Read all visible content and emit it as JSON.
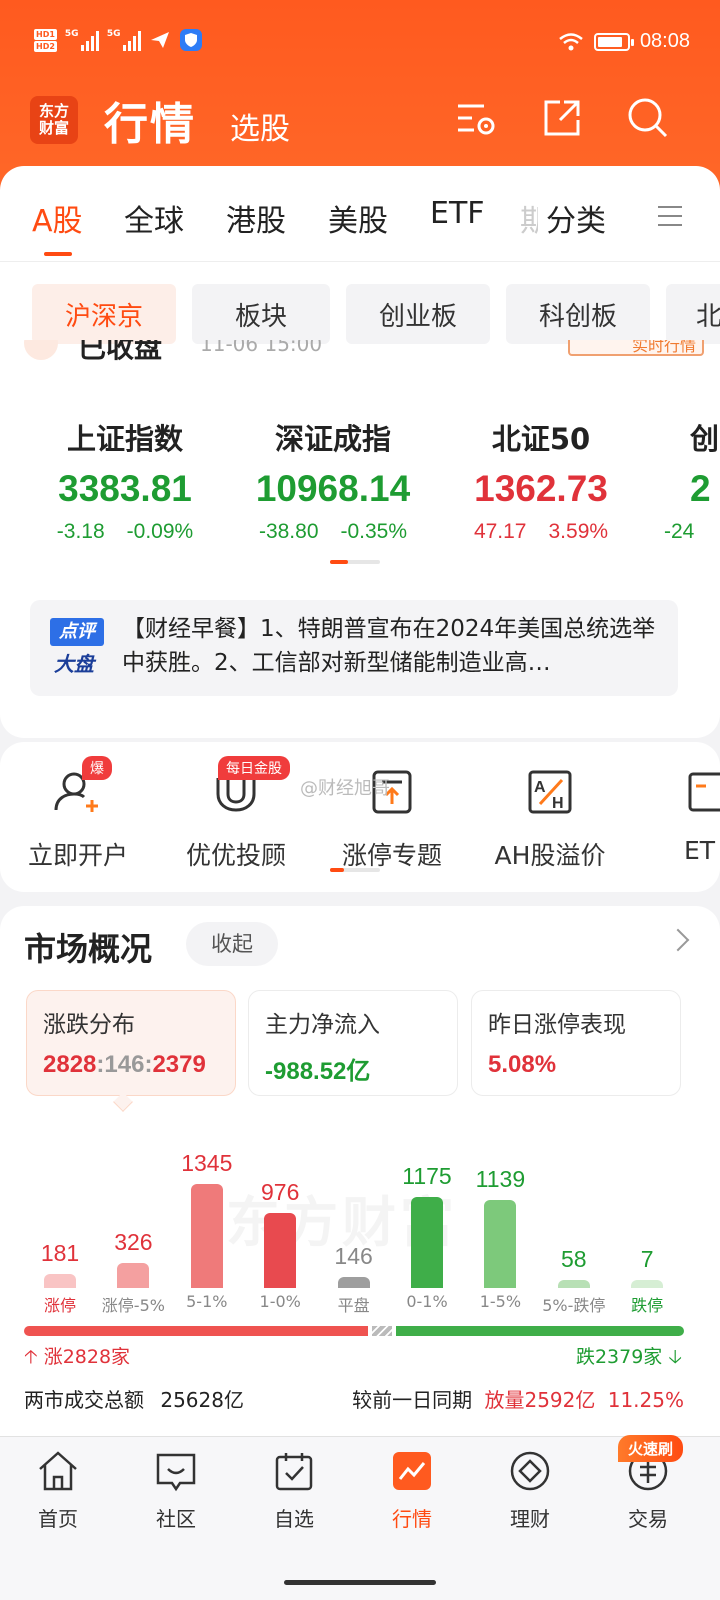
{
  "status_bar": {
    "hd1": "HD1",
    "hd2": "HD2",
    "net1": "5G",
    "net2": "5G",
    "time": "08:08"
  },
  "header": {
    "logo_line1": "东方",
    "logo_line2": "财富",
    "title": "行情",
    "subtitle": "选股"
  },
  "tabs": [
    {
      "label": "A股",
      "active": true
    },
    {
      "label": "全球"
    },
    {
      "label": "港股"
    },
    {
      "label": "美股"
    },
    {
      "label": "ETF"
    },
    {
      "label": "期"
    },
    {
      "label": "分类"
    }
  ],
  "chips": [
    {
      "label": "沪深京",
      "active": true
    },
    {
      "label": "板块"
    },
    {
      "label": "创业板"
    },
    {
      "label": "科创板"
    },
    {
      "label": "北"
    }
  ],
  "market_closed": {
    "label": "已收盘",
    "datetime": "11-06 15:00",
    "badge": "实时行情"
  },
  "indices": [
    {
      "name": "上证指数",
      "value": "3383.81",
      "change": "-3.18",
      "pct": "-0.09%",
      "dir": "down"
    },
    {
      "name": "深证成指",
      "value": "10968.14",
      "change": "-38.80",
      "pct": "-0.35%",
      "dir": "down"
    },
    {
      "name": "北证50",
      "value": "1362.73",
      "change": "47.17",
      "pct": "3.59%",
      "dir": "up"
    },
    {
      "name": "创",
      "value": "2",
      "change": "-24",
      "pct": "",
      "dir": "down"
    }
  ],
  "news": {
    "badge_line1": "点评",
    "badge_line2": "大盘",
    "text": "【财经早餐】1、特朗普宣布在2024年美国总统选举中获胜。2、工信部对新型储能制造业高…"
  },
  "quick": {
    "watermark": "@财经旭哥",
    "items": [
      {
        "label": "立即开户",
        "tag": "爆",
        "icon": "add-user-icon"
      },
      {
        "label": "优优投顾",
        "tag": "每日金股",
        "icon": "magnet-icon"
      },
      {
        "label": "涨停专题",
        "icon": "limit-up-icon"
      },
      {
        "label": "AH股溢价",
        "icon": "ah-premium-icon"
      },
      {
        "label": "ET",
        "icon": "etf-icon"
      }
    ]
  },
  "market": {
    "title": "市场概况",
    "collapse": "收起",
    "stats": [
      {
        "label": "涨跌分布",
        "value_up": "2828",
        "value_flat": "146",
        "value_down": "2379",
        "sep": ":"
      },
      {
        "label": "主力净流入",
        "value": "-988.52亿"
      },
      {
        "label": "昨日涨停表现",
        "value": "5.08%"
      }
    ],
    "watermark": "东方财富",
    "up_label": "涨2828家",
    "down_label": "跌2379家",
    "volume_label": "两市成交总额",
    "volume_value": "25628亿",
    "compare_label": "较前一日同期",
    "compare_value": "放量2592亿",
    "compare_pct": "11.25%"
  },
  "chart_data": {
    "type": "bar",
    "categories": [
      "涨停",
      "涨停-5%",
      "5-1%",
      "1-0%",
      "平盘",
      "0-1%",
      "1-5%",
      "5%-跌停",
      "跌停"
    ],
    "values": [
      181,
      326,
      1345,
      976,
      146,
      1175,
      1139,
      58,
      7
    ],
    "colors": [
      "#f9c4c4",
      "#f4a0a0",
      "#ef7a7a",
      "#e84a4f",
      "#9e9e9e",
      "#3fae49",
      "#7dc97b",
      "#b8e0b5",
      "#d6eed4"
    ],
    "label_colors": [
      "#e0323a",
      "#e0323a",
      "#e0323a",
      "#e0323a",
      "#888888",
      "#1e9c32",
      "#1e9c32",
      "#1e9c32",
      "#1e9c32"
    ],
    "tick_colors": [
      "#e0323a",
      "#888888",
      "#888888",
      "#888888",
      "#888888",
      "#888888",
      "#888888",
      "#888888",
      "#1e9c32"
    ]
  },
  "ratio": {
    "up": 2828,
    "flat": 146,
    "down": 2379
  },
  "bottom_nav": {
    "hot_tag": "火速刷",
    "items": [
      {
        "label": "首页",
        "icon": "home-icon"
      },
      {
        "label": "社区",
        "icon": "community-icon"
      },
      {
        "label": "自选",
        "icon": "watchlist-icon"
      },
      {
        "label": "行情",
        "icon": "market-icon",
        "active": true
      },
      {
        "label": "理财",
        "icon": "wealth-icon"
      },
      {
        "label": "交易",
        "icon": "trade-icon"
      }
    ]
  },
  "colors": {
    "brand": "#ff5a1f",
    "up": "#e0323a",
    "down": "#1e9c32"
  }
}
